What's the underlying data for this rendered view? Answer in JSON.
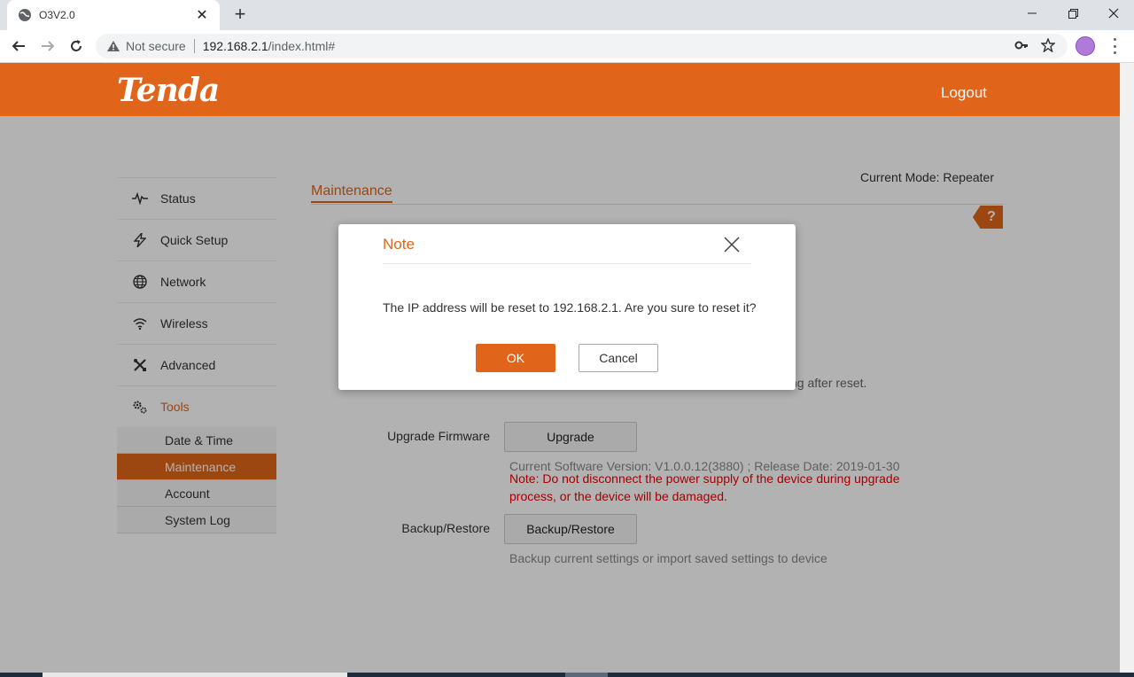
{
  "browser": {
    "tab_title": "O3V2.0",
    "tab_close": "✕",
    "new_tab": "+",
    "not_secure": "Not secure",
    "url_host": "192.168.2.1",
    "url_path": "/index.html#"
  },
  "header": {
    "logo": "Tenda",
    "logout": "Logout",
    "brand_color": "#e0651b"
  },
  "sidebar": {
    "items": [
      {
        "label": "Status",
        "icon": "status-icon"
      },
      {
        "label": "Quick Setup",
        "icon": "lightning-icon"
      },
      {
        "label": "Network",
        "icon": "globe-icon"
      },
      {
        "label": "Wireless",
        "icon": "wifi-icon"
      },
      {
        "label": "Advanced",
        "icon": "tools-icon"
      },
      {
        "label": "Tools",
        "icon": "gears-icon"
      }
    ],
    "subitems": [
      "Date & Time",
      "Maintenance",
      "Account",
      "System Log"
    ],
    "active_subitem": "Maintenance"
  },
  "content": {
    "mode": "Current Mode: Repeater",
    "section_title": "Maintenance",
    "help": "?",
    "reset_hint_partial": "ng after reset.",
    "upgrade_label": "Upgrade Firmware",
    "upgrade_button": "Upgrade",
    "software_version": "Current Software Version: V1.0.0.12(3880) ; Release Date: 2019-01-30",
    "upgrade_warning": "Note: Do not disconnect the power supply of the device during upgrade process, or the device will be damaged.",
    "backup_label": "Backup/Restore",
    "backup_button": "Backup/Restore",
    "backup_hint": "Backup current settings or import saved settings to device"
  },
  "dialog": {
    "title": "Note",
    "message": "The IP address will be reset to 192.168.2.1. Are you sure to reset it?",
    "ok": "OK",
    "cancel": "Cancel"
  }
}
